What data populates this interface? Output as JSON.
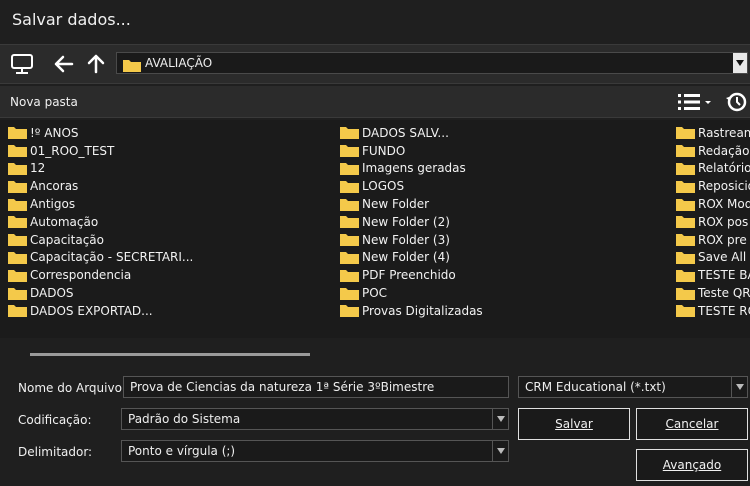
{
  "dialog": {
    "title": "Salvar dados..."
  },
  "navigation": {
    "path": "AVALIAÇÃO",
    "icons": [
      "monitor-icon",
      "back-arrow-icon",
      "up-arrow-icon",
      "chevron-down-icon"
    ]
  },
  "toolbar": {
    "new_folder_label": "Nova pasta",
    "icons": [
      "view-list-icon",
      "history-icon"
    ]
  },
  "folders": {
    "column1": [
      "!º ANOS",
      "01_ROO_TEST",
      "12",
      "Ancoras",
      "Antigos",
      "Automação",
      "Capacitação",
      "Capacitação - SECRETARI...",
      "Correspondencia",
      "DADOS",
      "DADOS EXPORTAD..."
    ],
    "column2": [
      "DADOS SALV...",
      "FUNDO",
      "Imagens geradas",
      "LOGOS",
      "New Folder",
      "New Folder (2)",
      "New Folder (3)",
      "New Folder (4)",
      "PDF Preenchido",
      "POC",
      "Provas Digitalizadas"
    ],
    "column3": [
      "Rastreame",
      "Redação",
      "Relatórios",
      "Reposicio",
      "ROX Mod",
      "ROX pos",
      "ROX pre",
      "Save All",
      "TESTE BAR",
      "Teste QRC",
      "TESTE ROX"
    ]
  },
  "form": {
    "filename_label": "Nome do Arquivo",
    "filename_value": "Prova de Ciencias da natureza 1ª Série 3ºBimestre",
    "filetype_value": "CRM Educational (*.txt)",
    "encoding_label": "Codificação:",
    "encoding_value": "Padrão do Sistema",
    "delimiter_label": "Delimitador:",
    "delimiter_value": "Ponto e vírgula (;)"
  },
  "buttons": {
    "save": "Salvar",
    "cancel": "Cancelar",
    "advanced": "Avançado"
  },
  "colors": {
    "background": "#1f1f1f",
    "folder": "#f4c94a",
    "text": "#f0f0f0"
  }
}
